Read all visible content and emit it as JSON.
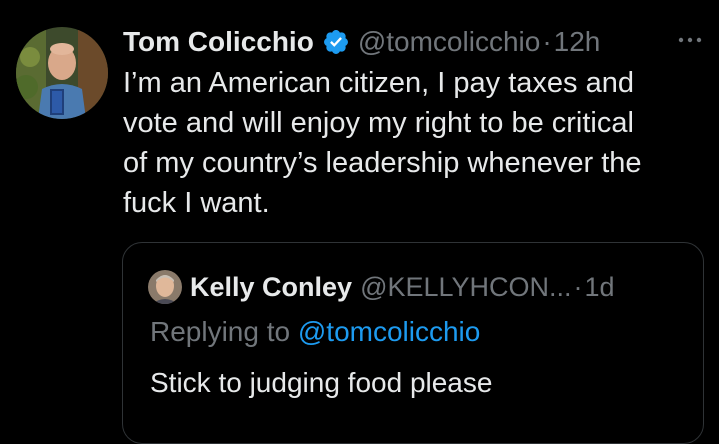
{
  "tweet": {
    "author": {
      "display_name": "Tom Colicchio",
      "handle": "@tomcolicchio",
      "verified_icon": "verified-badge-icon",
      "avatar": "profile-photo"
    },
    "separator": "·",
    "time": "12h",
    "more_icon": "more-horizontal-icon",
    "text_lines": [
      "I’m an American citizen,  I pay taxes and",
      "vote and will enjoy my right to be critical",
      "of my country’s leadership whenever the",
      "fuck I want."
    ]
  },
  "quoted_tweet": {
    "author": {
      "display_name": "Kelly Conley",
      "handle": "@KELLYHCON...",
      "avatar": "profile-photo"
    },
    "separator": "·",
    "time": "1d",
    "replying_prefix": "Replying to",
    "replying_to": "@tomcolicchio",
    "text": "Stick to judging food please"
  },
  "colors": {
    "background": "#000000",
    "primary_text": "#e7e9ea",
    "secondary_text": "#71767b",
    "accent": "#1d9bf0",
    "border": "#2f3336"
  }
}
